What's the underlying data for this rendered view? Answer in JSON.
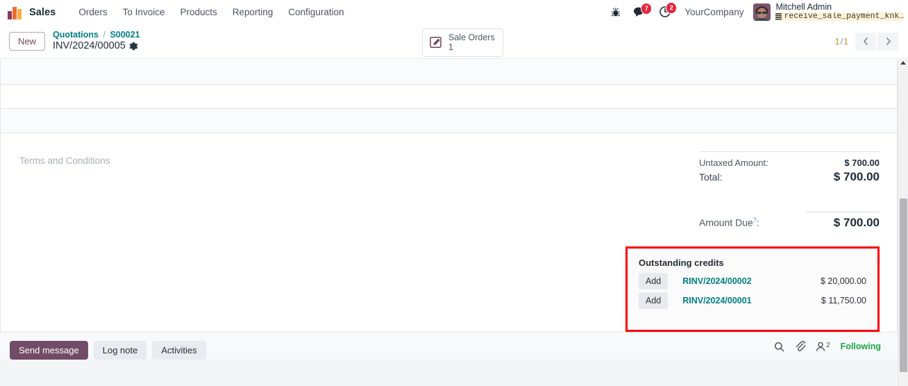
{
  "navbar": {
    "brand": "Sales",
    "menu": [
      "Orders",
      "To Invoice",
      "Products",
      "Reporting",
      "Configuration"
    ],
    "icons": [
      {
        "name": "bug-icon",
        "badge": ""
      },
      {
        "name": "messages-icon",
        "badge": "7"
      },
      {
        "name": "activities-clock-icon",
        "badge": "2"
      }
    ],
    "company": "YourCompany",
    "user_name": "Mitchell Admin",
    "user_db": "receive_sale_payment_knk…"
  },
  "control_panel": {
    "new_label": "New",
    "breadcrumb_root": "Quotations",
    "breadcrumb_sep": "/",
    "breadcrumb_parent": "S00021",
    "record_name": "INV/2024/00005",
    "stat_button": {
      "label": "Sale Orders",
      "value": "1"
    },
    "pager": {
      "current": "1",
      "sep": "/",
      "total": "1"
    }
  },
  "sheet": {
    "terms_placeholder": "Terms and Conditions",
    "totals": [
      {
        "label": "Untaxed Amount:",
        "value": "$ 700.00"
      },
      {
        "label": "Total:",
        "value": "$ 700.00"
      }
    ],
    "amount_due": {
      "label": "Amount Due",
      "help": "?",
      "colon": ":",
      "value": "$ 700.00"
    },
    "outstanding_credits": {
      "title": "Outstanding credits",
      "add_label": "Add",
      "rows": [
        {
          "name": "RINV/2024/00002",
          "amount": "$ 20,000.00"
        },
        {
          "name": "RINV/2024/00001",
          "amount": "$ 11,750.00"
        }
      ]
    }
  },
  "chatter": {
    "send_message": "Send message",
    "log_note": "Log note",
    "activities": "Activities",
    "follower_count": "2",
    "following": "Following"
  },
  "colors": {
    "accent": "#714b67",
    "link": "#017e84",
    "highlight": "#ff0000",
    "badge": "#e4263f",
    "following": "#1aa544"
  }
}
